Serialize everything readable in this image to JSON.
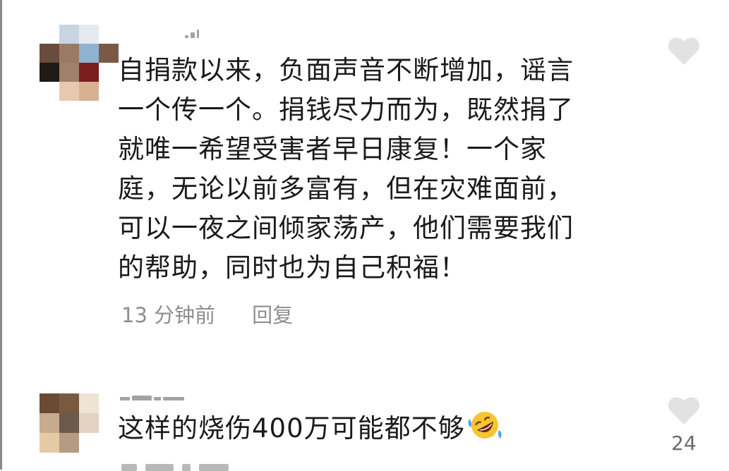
{
  "comments": [
    {
      "text": "自捐款以来，负面声音不断增加，谣言\n一个传一个。捐钱尽力而为，既然捐了\n就唯一希望受害者早日康复！一个家\n庭，无论以前多富有，但在灾难面前，\n可以一夜之间倾家荡产，他们需要我们\n的帮助，同时也为自己积福！",
      "time": "13 分钟前",
      "reply_label": "回复",
      "like_icon": "heart-outline-icon"
    },
    {
      "text": "这样的烧伤400万可能都不够",
      "emoji": "rolling-on-floor-laughing-emoji",
      "like_icon": "heart-outline-icon",
      "like_count": "24"
    }
  ],
  "colors": {
    "text": "#1a1a1a",
    "meta": "#8e8e8e",
    "heart": "#e2e2e2"
  }
}
